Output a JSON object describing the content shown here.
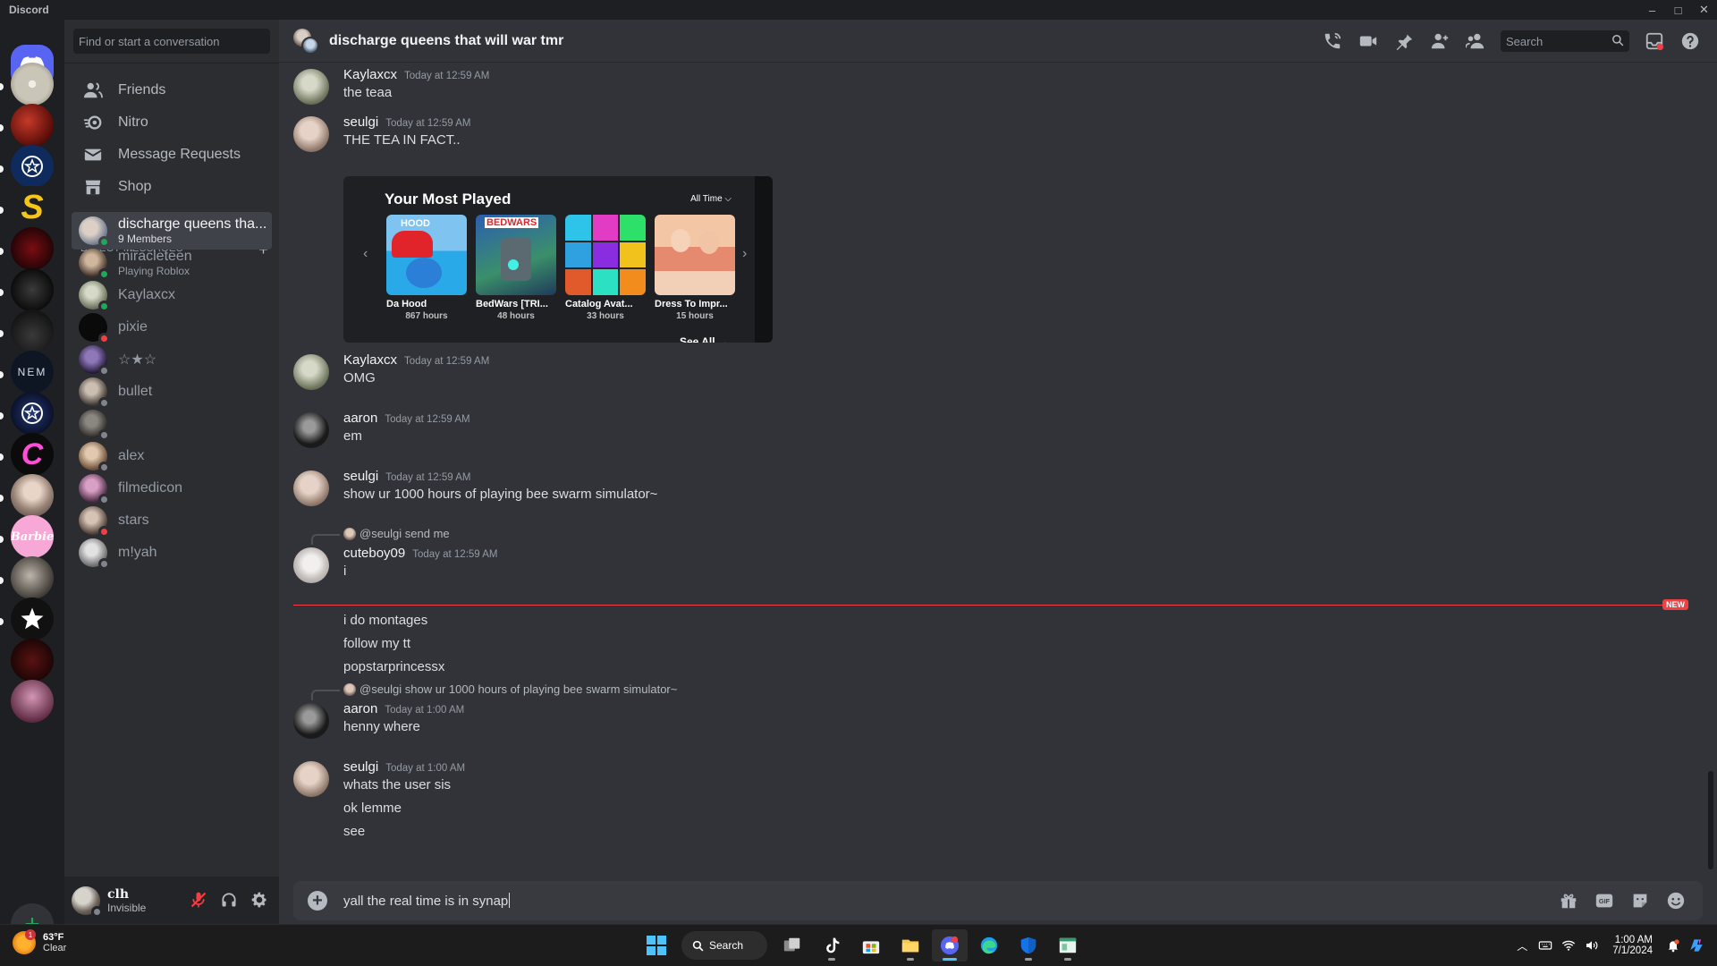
{
  "window": {
    "title": "Discord",
    "controls": [
      "–",
      "□",
      "✕"
    ]
  },
  "servers": {
    "home_icon": "discord-logo-icon",
    "add_icon": "add-server-icon"
  },
  "sidebar": {
    "search_placeholder": "Find or start a conversation",
    "nav": [
      {
        "label": "Friends",
        "icon": "friends-icon"
      },
      {
        "label": "Nitro",
        "icon": "nitro-icon"
      },
      {
        "label": "Message Requests",
        "icon": "envelope-icon"
      },
      {
        "label": "Shop",
        "icon": "shop-icon"
      }
    ],
    "dm_header": "DIRECT MESSAGES",
    "dms": [
      {
        "name": "discharge queens tha...",
        "sub": "9 Members",
        "status": "none",
        "active": true
      },
      {
        "name": "miracleteen",
        "sub": "Playing Roblox",
        "status": "online"
      },
      {
        "name": "Kaylaxcx",
        "sub": "",
        "status": "online"
      },
      {
        "name": "pixie",
        "sub": "",
        "status": "dnd"
      },
      {
        "name": "☆★☆",
        "sub": "",
        "status": "offline"
      },
      {
        "name": "bullet",
        "sub": "",
        "status": "offline"
      },
      {
        "name": "",
        "sub": "",
        "status": "offline"
      },
      {
        "name": "alex",
        "sub": "",
        "status": "offline"
      },
      {
        "name": "filmedicon",
        "sub": "",
        "status": "offline"
      },
      {
        "name": "stars",
        "sub": "",
        "status": "dnd"
      },
      {
        "name": "m!yah",
        "sub": "",
        "status": "offline"
      }
    ]
  },
  "user": {
    "name": "clh",
    "status": "Invisible"
  },
  "chat": {
    "title": "discharge queens that will war tmr",
    "search_placeholder": "Search",
    "messages": {
      "m1": {
        "author": "Kaylaxcx",
        "time": "Today at 12:59 AM",
        "lines": [
          "the teaa"
        ]
      },
      "m2": {
        "author": "seulgi",
        "time": "Today at 12:59 AM",
        "lines": [
          "THE TEA IN FACT.."
        ]
      },
      "m3": {
        "author": "Kaylaxcx",
        "time": "Today at 12:59 AM",
        "lines": [
          "OMG"
        ]
      },
      "m4": {
        "author": "aaron",
        "time": "Today at 12:59 AM",
        "lines": [
          "em"
        ]
      },
      "m5": {
        "author": "seulgi",
        "time": "Today at 12:59 AM",
        "lines": [
          "show ur 1000 hours of playing bee swarm simulator~"
        ]
      },
      "m6": {
        "reply": "@seulgi send me",
        "author": "cuteboy09",
        "time": "Today at 12:59 AM",
        "lines": [
          "i",
          "i do montages",
          "follow my tt",
          "popstarprincessx"
        ]
      },
      "m7": {
        "reply": "@seulgi show ur 1000 hours of playing bee swarm simulator~",
        "author": "aaron",
        "time": "Today at 1:00 AM",
        "lines": [
          "henny where"
        ]
      },
      "m8": {
        "author": "seulgi",
        "time": "Today at 1:00 AM",
        "lines": [
          "whats the user sis",
          "ok lemme",
          "see"
        ]
      }
    },
    "embed": {
      "title": "Your Most Played",
      "filter": "All Time",
      "see_all": "See All",
      "games": [
        {
          "name": "Da Hood",
          "hours": "867 hours",
          "thumb_label": "HOOD"
        },
        {
          "name": "BedWars [TRI...",
          "hours": "48 hours",
          "thumb_label": "BEDWARS"
        },
        {
          "name": "Catalog Avat...",
          "hours": "33 hours",
          "thumb_label": ""
        },
        {
          "name": "Dress To Impr...",
          "hours": "15 hours",
          "thumb_label": ""
        }
      ]
    },
    "new_badge": "NEW",
    "composer_value": "yall the real time is in synap"
  },
  "taskbar": {
    "weather_temp": "63°F",
    "weather_cond": "Clear",
    "weather_badge": "1",
    "search_label": "Search",
    "time": "1:00 AM",
    "date": "7/1/2024"
  },
  "colors": {
    "accent": "#5865f2",
    "online": "#23a55a",
    "dnd": "#f23f43",
    "offline": "#80848e",
    "new_divider": "#f23f43"
  }
}
